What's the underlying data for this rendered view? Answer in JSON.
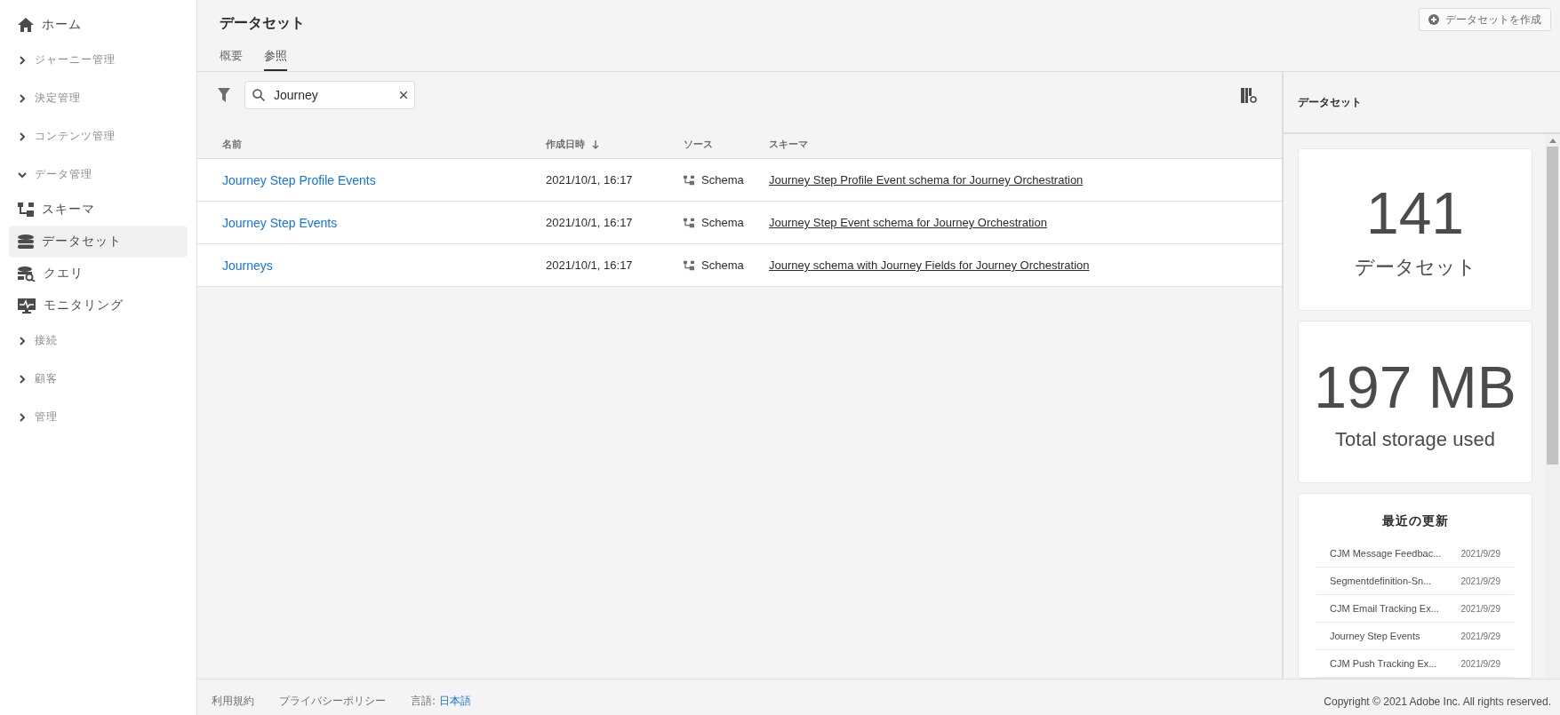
{
  "sidebar": {
    "items": [
      {
        "kind": "link",
        "label": "ホーム",
        "selected": false
      },
      {
        "kind": "section",
        "label": "ジャーニー管理",
        "expanded": false
      },
      {
        "kind": "section",
        "label": "決定管理",
        "expanded": false
      },
      {
        "kind": "section",
        "label": "コンテンツ管理",
        "expanded": false
      },
      {
        "kind": "section",
        "label": "データ管理",
        "expanded": true
      },
      {
        "kind": "link",
        "label": "スキーマ",
        "selected": false
      },
      {
        "kind": "link",
        "label": "データセット",
        "selected": true
      },
      {
        "kind": "link",
        "label": "クエリ",
        "selected": false
      },
      {
        "kind": "link",
        "label": "モニタリング",
        "selected": false
      },
      {
        "kind": "section",
        "label": "接続",
        "expanded": false
      },
      {
        "kind": "section",
        "label": "顧客",
        "expanded": false
      },
      {
        "kind": "section",
        "label": "管理",
        "expanded": false
      }
    ]
  },
  "header": {
    "title": "データセット",
    "create_button": "データセットを作成"
  },
  "tabs": [
    {
      "label": "概要",
      "selected": false
    },
    {
      "label": "参照",
      "selected": true
    }
  ],
  "search": {
    "value": "Journey"
  },
  "table": {
    "columns": [
      "名前",
      "作成日時",
      "ソース",
      "スキーマ"
    ],
    "rows": [
      {
        "name": "Journey Step Profile Events",
        "created": "2021/10/1, 16:17",
        "source": "Schema",
        "schema": "Journey Step Profile Event schema for Journey Orchestration"
      },
      {
        "name": "Journey Step Events",
        "created": "2021/10/1, 16:17",
        "source": "Schema",
        "schema": "Journey Step Event schema for Journey Orchestration"
      },
      {
        "name": "Journeys",
        "created": "2021/10/1, 16:17",
        "source": "Schema",
        "schema": "Journey schema with Journey Fields for Journey Orchestration"
      }
    ]
  },
  "panel": {
    "title": "データセット",
    "stats": [
      {
        "value": "141",
        "label": "データセット"
      },
      {
        "value": "197 MB",
        "label": "Total storage used"
      }
    ],
    "recent": {
      "title": "最近の更新",
      "items": [
        {
          "name": "CJM Message Feedbac...",
          "date": "2021/9/29"
        },
        {
          "name": "Segmentdefinition-Sn...",
          "date": "2021/9/29"
        },
        {
          "name": "CJM Email Tracking Ex...",
          "date": "2021/9/29"
        },
        {
          "name": "Journey Step Events",
          "date": "2021/9/29"
        },
        {
          "name": "CJM Push Tracking Ex...",
          "date": "2021/9/29"
        }
      ]
    }
  },
  "footer": {
    "links": [
      "利用規約",
      "プライバシーポリシー"
    ],
    "language_label": "言語:",
    "language": "日本語",
    "copyright": "Copyright ©  2021 Adobe Inc.  All rights reserved."
  }
}
